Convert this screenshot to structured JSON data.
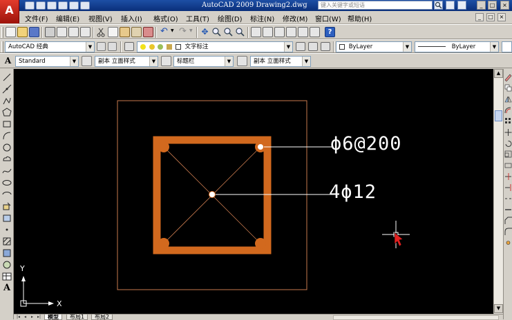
{
  "app": {
    "logo_letter": "A",
    "window_title": "AutoCAD 2009 Drawing2.dwg",
    "help_search_placeholder": "键入关键字或短语"
  },
  "menu": {
    "items": [
      "文件(F)",
      "编辑(E)",
      "视图(V)",
      "插入(I)",
      "格式(O)",
      "工具(T)",
      "绘图(D)",
      "标注(N)",
      "修改(M)",
      "窗口(W)",
      "帮助(H)"
    ]
  },
  "workspace": {
    "name": "AutoCAD 经典",
    "current_layer": "文字标注"
  },
  "properties": {
    "color": "ByLayer",
    "linetype": "ByLayer"
  },
  "styles": {
    "text_style": "Standard",
    "dim_style": "副本 立面样式",
    "table_style": "标题栏",
    "multileader_style": "副本 立面样式"
  },
  "drawing": {
    "stirrup_label": "ϕ6@200",
    "main_rebar_label": "4ϕ12",
    "colors": {
      "background": "#000000",
      "section": "#d2691e",
      "border": "#c87a4e",
      "leader": "#ffffff",
      "cursor_arrow": "#e02020"
    }
  },
  "ucs": {
    "x_label": "X",
    "y_label": "Y"
  },
  "tabs": [
    "模型",
    "布局1",
    "布局2"
  ],
  "icons": {
    "close": "×",
    "minimize": "_",
    "maximize": "□",
    "dropdown": "▼",
    "scroll_up": "▲",
    "scroll_down": "▼"
  }
}
